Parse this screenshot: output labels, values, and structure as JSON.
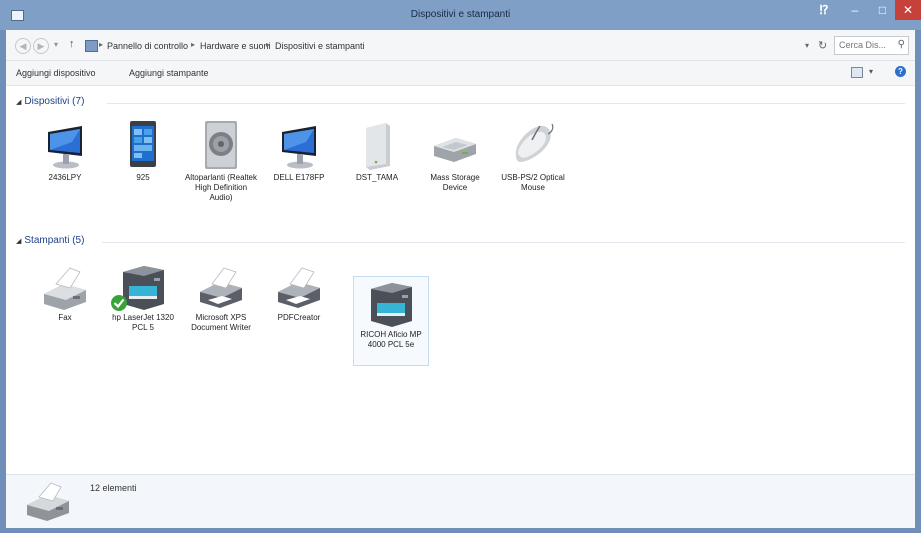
{
  "window": {
    "title": "Dispositivi e stampanti",
    "help_glyph": "⁉",
    "minimize_glyph": "–",
    "maximize_glyph": "□",
    "close_glyph": "✕"
  },
  "address": {
    "breadcrumbs": [
      "Pannello di controllo",
      "Hardware e suoni",
      "Dispositivi e stampanti"
    ],
    "separator": "▸",
    "search_placeholder": "Cerca Dis..."
  },
  "commands": {
    "add_device": "Aggiungi dispositivo",
    "add_printer": "Aggiungi stampante"
  },
  "groups": [
    {
      "title": "Dispositivi (7)",
      "items": [
        {
          "label": "2436LPY",
          "icon": "monitor-icon"
        },
        {
          "label": "925",
          "icon": "phone-icon"
        },
        {
          "label": "Altoparlanti (Realtek High Definition Audio)",
          "icon": "speaker-icon"
        },
        {
          "label": "DELL E178FP",
          "icon": "monitor-icon"
        },
        {
          "label": "DST_TAMA",
          "icon": "external-drive-icon"
        },
        {
          "label": "Mass Storage Device",
          "icon": "storage-device-icon"
        },
        {
          "label": "USB-PS/2 Optical Mouse",
          "icon": "mouse-icon"
        }
      ]
    },
    {
      "title": "Stampanti (5)",
      "items": [
        {
          "label": "Fax",
          "icon": "fax-icon"
        },
        {
          "label": "hp LaserJet 1320 PCL 5",
          "icon": "multifunction-printer-icon",
          "is_default": true
        },
        {
          "label": "Microsoft XPS Document Writer",
          "icon": "printer-icon"
        },
        {
          "label": "PDFCreator",
          "icon": "printer-icon"
        },
        {
          "label": "RICOH Aficio MP 4000 PCL 5e",
          "icon": "multifunction-printer-icon",
          "selected": true
        }
      ]
    }
  ],
  "status": {
    "count_text": "12 elementi",
    "icon": "fax-icon"
  }
}
